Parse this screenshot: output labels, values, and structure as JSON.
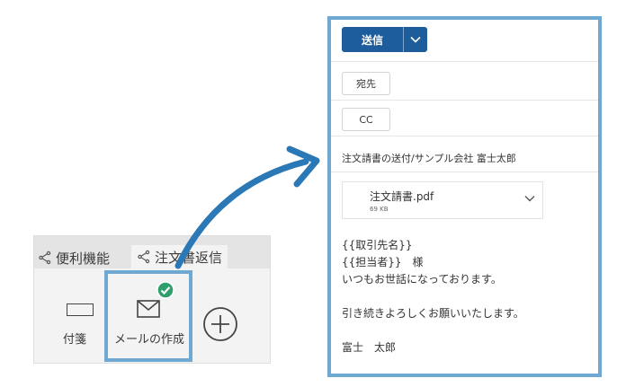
{
  "ribbon": {
    "tabs": [
      {
        "label": "便利機能",
        "icon": "share-icon"
      },
      {
        "label": "注文書返信",
        "icon": "share-icon"
      }
    ],
    "buttons": {
      "sticky_note": {
        "label": "付箋",
        "icon": "sticky-note-icon"
      },
      "compose_mail": {
        "label": "メールの作成",
        "icon": "mail-icon",
        "badge_icon": "check-icon"
      },
      "add": {
        "icon": "add-circle-icon"
      }
    }
  },
  "compose": {
    "send_label": "送信",
    "to_label": "宛先",
    "cc_label": "CC",
    "subject": "注文請書の送付/サンプル会社 富士太郎",
    "attachment": {
      "name": "注文請書.pdf",
      "size": "69 KB"
    },
    "body": "{{取引先名}}\n{{担当者}}　様\nいつもお世話になっております。\n\n引き続きよろしくお願いいたします。\n\n富士　太郎"
  },
  "colors": {
    "highlight": "#6fa8d0",
    "send_button": "#1e5d9b",
    "arrow": "#2b78b6",
    "check_badge": "#2e9e6b"
  }
}
